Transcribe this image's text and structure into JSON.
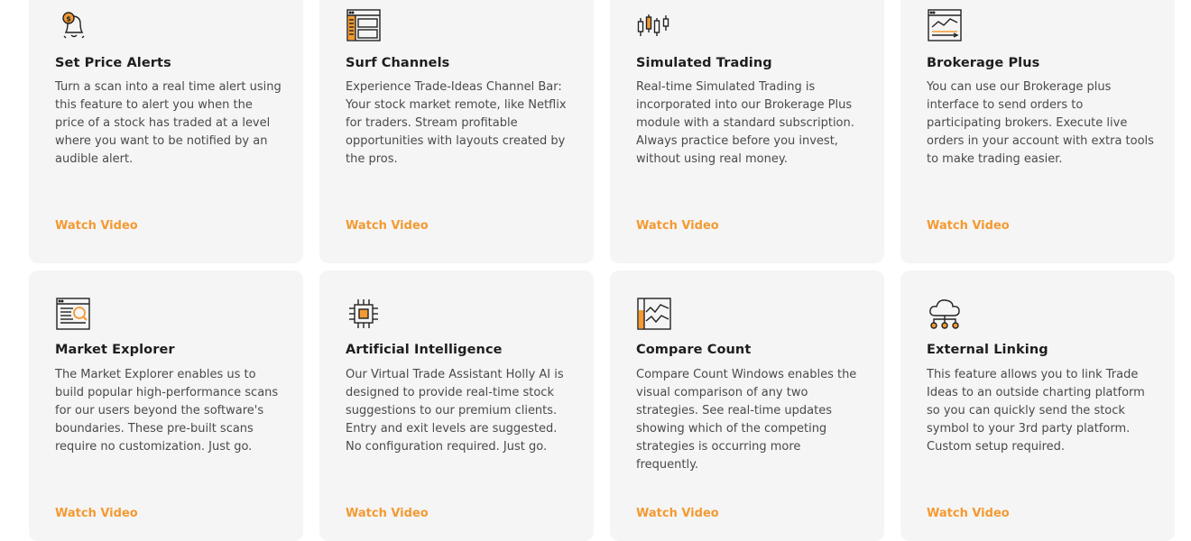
{
  "accent_color": "#f39a32",
  "features": [
    {
      "icon": "bell-dollar-icon",
      "title": "Set Price Alerts",
      "description": "Turn a scan into a real time alert using this feature to alert you when the price of a stock has traded at a level where you want to be notified by an audible alert.",
      "link": "Watch Video"
    },
    {
      "icon": "channel-bar-icon",
      "title": "Surf Channels",
      "description": "Experience Trade-Ideas Channel Bar: Your stock market remote, like Netflix for traders. Stream profitable opportunities with layouts created by the pros.",
      "link": "Watch Video"
    },
    {
      "icon": "candlestick-icon",
      "title": "Simulated Trading",
      "description": "Real-time Simulated Trading is incorporated into our Brokerage Plus module with a standard subscription. Always practice before you invest, without using real money.",
      "link": "Watch Video"
    },
    {
      "icon": "brokerage-chart-icon",
      "title": "Brokerage Plus",
      "description": "You can use our Brokerage plus interface to send orders to participating brokers. Execute live orders in your account with extra tools to make trading easier.",
      "link": "Watch Video"
    },
    {
      "icon": "market-explorer-icon",
      "title": "Market Explorer",
      "description": "The Market Explorer enables us to build popular high-performance scans for our users beyond the software's boundaries. These pre-built scans require no customization. Just go.",
      "link": "Watch Video"
    },
    {
      "icon": "chip-icon",
      "title": "Artificial Intelligence",
      "description": "Our Virtual Trade Assistant Holly AI is designed to provide real-time stock suggestions to our premium clients. Entry and exit levels are suggested. No configuration required. Just go.",
      "link": "Watch Video"
    },
    {
      "icon": "compare-chart-icon",
      "title": "Compare Count",
      "description": "Compare Count Windows enables the visual comparison of any two strategies. See real-time updates showing which of the competing strategies is occurring more frequently.",
      "link": "Watch Video"
    },
    {
      "icon": "cloud-network-icon",
      "title": "External Linking",
      "description": "This feature allows you to link Trade Ideas to an outside charting platform so you can quickly send the stock symbol to your 3rd party platform. Custom setup required.",
      "link": "Watch Video"
    }
  ]
}
